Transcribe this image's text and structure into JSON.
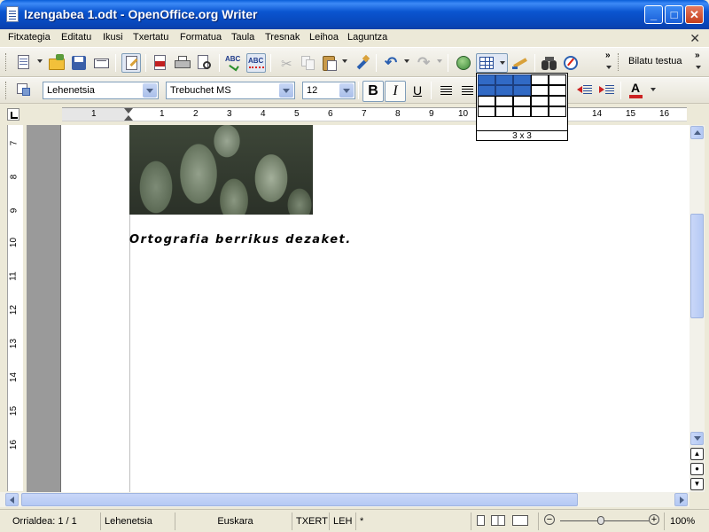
{
  "window": {
    "title": "Izengabea 1.odt - OpenOffice.org Writer"
  },
  "menu": {
    "items": [
      "Fitxategia",
      "Editatu",
      "Ikusi",
      "Txertatu",
      "Formatua",
      "Taula",
      "Tresnak",
      "Leihoa",
      "Laguntza"
    ]
  },
  "formatting": {
    "paragraph_style": "Lehenetsia",
    "font_name": "Trebuchet MS",
    "font_size": "12",
    "bold_label": "B",
    "italic_label": "I",
    "underline_label": "U"
  },
  "find": {
    "label": "Bilatu testua"
  },
  "table_popup": {
    "size_label": "3 x 3",
    "rows": 4,
    "cols": 5,
    "selected_rows": 2,
    "selected_cols": 3
  },
  "ruler": {
    "h_numbers": [
      "1",
      "1",
      "2",
      "3",
      "4",
      "5",
      "6",
      "7",
      "8",
      "9",
      "10",
      "14",
      "15",
      "16"
    ],
    "v_numbers": [
      "7",
      "8",
      "9",
      "10",
      "11",
      "12",
      "13",
      "14",
      "15",
      "16"
    ]
  },
  "document": {
    "text": "Ortografia berrikus dezaket."
  },
  "status": {
    "page": "Orrialdea: 1 / 1",
    "style": "Lehenetsia",
    "language": "Euskara",
    "insert_mode": "TXERT",
    "selection_mode": "LEH",
    "modified": "*",
    "zoom": "100%"
  },
  "colors": {
    "titlebar": "#0a55d0",
    "selection": "#316ac5"
  },
  "icons": [
    "new-document-icon",
    "open-folder-icon",
    "save-icon",
    "email-icon",
    "edit-file-icon",
    "export-pdf-icon",
    "print-icon",
    "print-preview-icon",
    "spellcheck-icon",
    "autospellcheck-icon",
    "cut-icon",
    "copy-icon",
    "paste-icon",
    "format-paintbrush-icon",
    "undo-icon",
    "redo-icon",
    "navigator-icon",
    "table-icon",
    "draw-functions-icon",
    "find-binoculars-icon",
    "gallery-icon"
  ]
}
